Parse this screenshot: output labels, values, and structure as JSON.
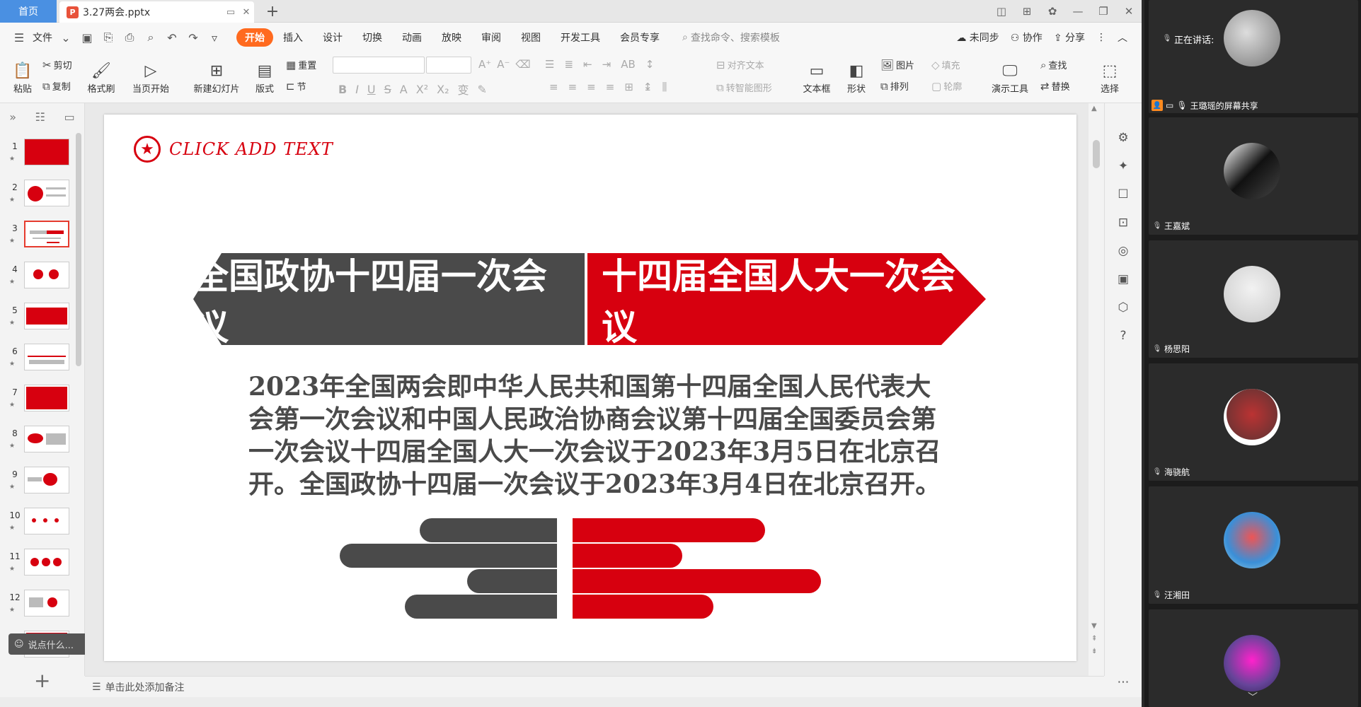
{
  "tabs": {
    "home": "首页",
    "doc_badge": "P",
    "doc_title": "3.27两会.pptx",
    "new_tab": "+"
  },
  "menu": {
    "file": "文件",
    "tabs": [
      "开始",
      "插入",
      "设计",
      "切换",
      "动画",
      "放映",
      "审阅",
      "视图",
      "开发工具",
      "会员专享"
    ],
    "search": "查找命令、搜索模板",
    "right": [
      "未同步",
      "协作",
      "分享"
    ]
  },
  "toolbar": {
    "paste": "粘贴",
    "cut": "剪切",
    "copy": "复制",
    "format_painter": "格式刷",
    "from_current": "当页开始",
    "new_slide": "新建幻灯片",
    "layout": "版式",
    "reset": "重置",
    "section": "节",
    "align_text": "对齐文本",
    "smart_art": "转智能图形",
    "textbox": "文本框",
    "shapes": "形状",
    "picture": "图片",
    "fill": "填充",
    "arrange": "排列",
    "outline": "轮廓",
    "present_tools": "演示工具",
    "find": "查找",
    "replace": "替换",
    "select": "选择"
  },
  "thumbnails": [
    "1",
    "2",
    "3",
    "4",
    "5",
    "6",
    "7",
    "8",
    "9",
    "10",
    "11",
    "12"
  ],
  "chat": {
    "placeholder": "说点什么..."
  },
  "slide": {
    "click_add": "CLICK ADD TEXT",
    "left_banner": "全国政协十四届一次会议",
    "right_banner": "十四届全国人大一次会议",
    "body": "2023年全国两会即中华人民共和国第十四届全国人民代表大会第一次会议和中国人民政治协商会议第十四届全国委员会第一次会议十四届全国人大一次会议于2023年3月5日在北京召开。全国政协十四届一次会议于2023年3月4日在北京召开。"
  },
  "notes": {
    "placeholder": "单击此处添加备注"
  },
  "meeting": {
    "speaking": "正在讲话:",
    "sharer": "王璐瑶的屏幕共享",
    "participants": [
      "王嘉斌",
      "杨思阳",
      "海骁航",
      "汪湘田"
    ]
  },
  "colors": {
    "red": "#d7000f",
    "dark": "#4a4a4a",
    "accent": "#ff6a1f"
  }
}
